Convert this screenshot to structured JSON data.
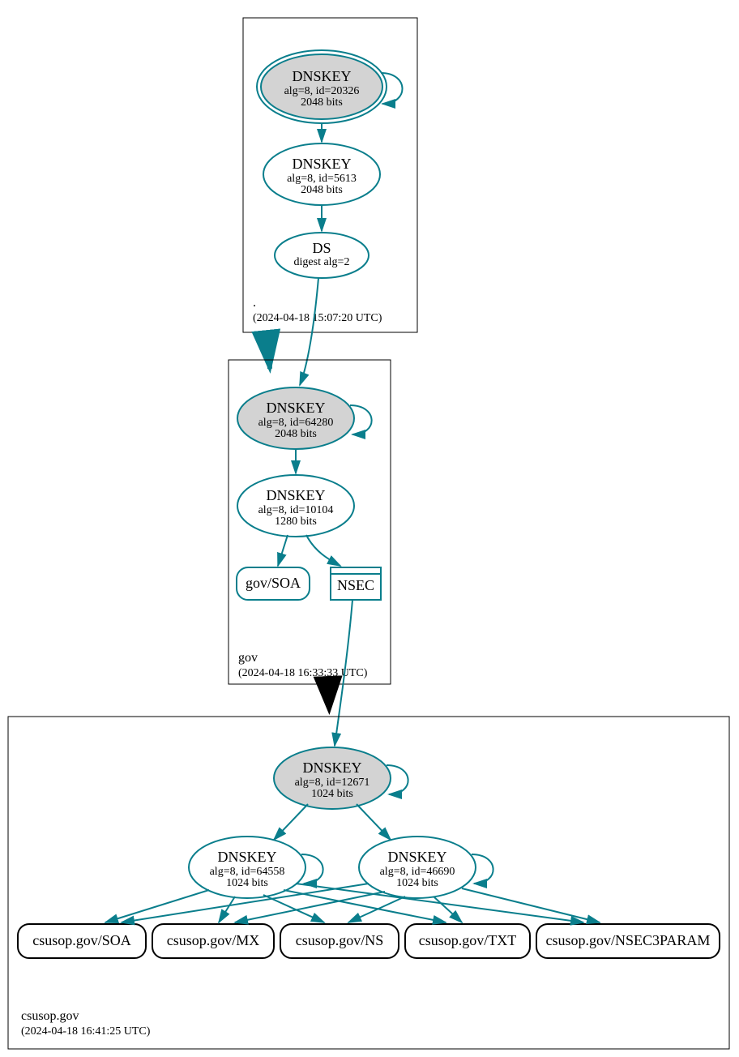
{
  "zones": {
    "root": {
      "name": ".",
      "timestamp": "(2024-04-18 15:07:20 UTC)",
      "ksk": {
        "title": "DNSKEY",
        "meta": "alg=8, id=20326",
        "bits": "2048 bits"
      },
      "zsk": {
        "title": "DNSKEY",
        "meta": "alg=8, id=5613",
        "bits": "2048 bits"
      },
      "ds": {
        "title": "DS",
        "meta": "digest alg=2"
      }
    },
    "gov": {
      "name": "gov",
      "timestamp": "(2024-04-18 16:33:33 UTC)",
      "ksk": {
        "title": "DNSKEY",
        "meta": "alg=8, id=64280",
        "bits": "2048 bits"
      },
      "zsk": {
        "title": "DNSKEY",
        "meta": "alg=8, id=10104",
        "bits": "1280 bits"
      },
      "soa": "gov/SOA",
      "nsec": "NSEC"
    },
    "csusop": {
      "name": "csusop.gov",
      "timestamp": "(2024-04-18 16:41:25 UTC)",
      "ksk": {
        "title": "DNSKEY",
        "meta": "alg=8, id=12671",
        "bits": "1024 bits"
      },
      "zsk1": {
        "title": "DNSKEY",
        "meta": "alg=8, id=64558",
        "bits": "1024 bits"
      },
      "zsk2": {
        "title": "DNSKEY",
        "meta": "alg=8, id=46690",
        "bits": "1024 bits"
      },
      "rr": {
        "soa": "csusop.gov/SOA",
        "mx": "csusop.gov/MX",
        "ns": "csusop.gov/NS",
        "txt": "csusop.gov/TXT",
        "nsec3param": "csusop.gov/NSEC3PARAM"
      }
    }
  }
}
